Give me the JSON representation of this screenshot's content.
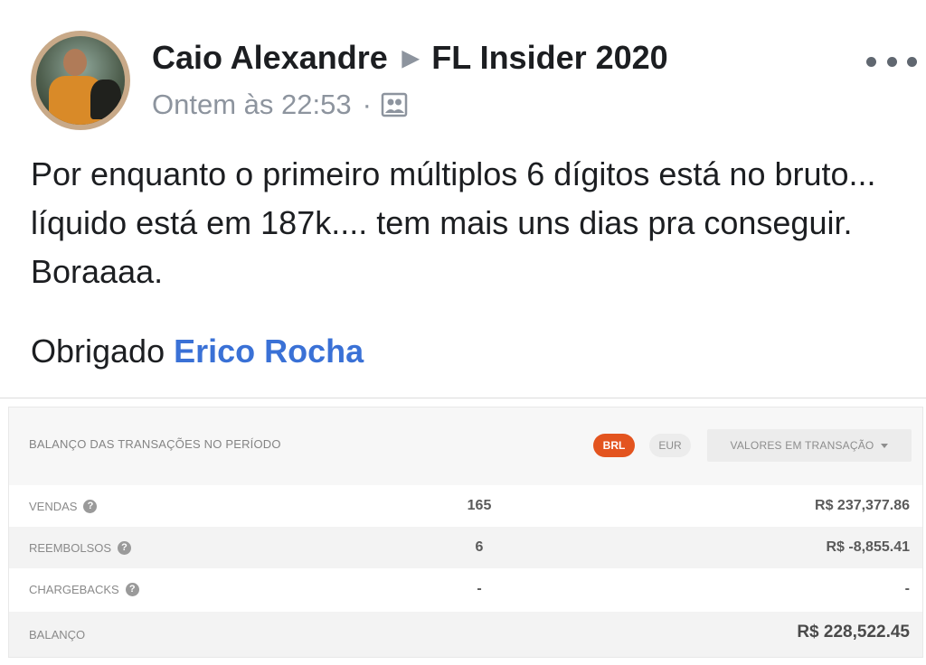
{
  "post": {
    "author": "Caio Alexandre",
    "group": "FL Insider 2020",
    "timestamp": "Ontem às 22:53",
    "separator": "·",
    "privacy_icon": "group-icon",
    "body": "Por enquanto o primeiro múltiplos 6 dígitos está no bruto... líquido está em 187k.... tem mais uns dias pra conseguir. Boraaaa.",
    "thanks_prefix": "Obrigado",
    "mention": "Erico Rocha"
  },
  "report": {
    "title": "BALANÇO DAS TRANSAÇÕES NO PERÍODO",
    "currency_active": "BRL",
    "currency_other": "EUR",
    "values_select": "VALORES EM TRANSAÇÃO",
    "rows": [
      {
        "label": "VENDAS",
        "count": "165",
        "amount": "R$ 237,377.86"
      },
      {
        "label": "REEMBOLSOS",
        "count": "6",
        "amount": "R$ -8,855.41"
      },
      {
        "label": "CHARGEBACKS",
        "count": "-",
        "amount": "-"
      },
      {
        "label": "BALANÇO",
        "count": "",
        "amount": "R$ 228,522.45"
      }
    ],
    "colors": {
      "accent": "#e3541f",
      "mention": "#3a71d6"
    }
  }
}
